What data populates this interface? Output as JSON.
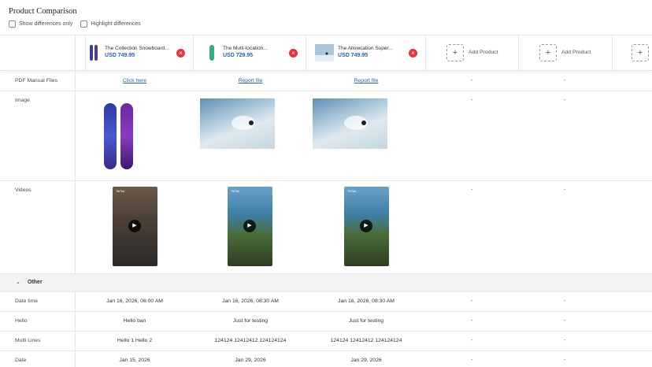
{
  "title": "Product Comparison",
  "options": {
    "show_differences_only": "Show differences only",
    "highlight_differences": "Highlight differences"
  },
  "products": [
    {
      "name": "The Collection Snowboard...",
      "price": "USD 749.95"
    },
    {
      "name": "The Multi-location...",
      "price": "USD 729.95"
    },
    {
      "name": "The Allowcation Super...",
      "price": "USD 749.95"
    }
  ],
  "add_product_label": "Add Product",
  "add_icon": "+",
  "remove_icon": "×",
  "dash": "-",
  "rows": {
    "pdf": {
      "label": "PDF Manual Files",
      "values": [
        "Click here",
        "Report file",
        "Report file"
      ]
    },
    "image": {
      "label": "Image"
    },
    "videos": {
      "label": "Videos",
      "video_tag": "TikTok"
    },
    "section": {
      "label": "Other",
      "icon": "chevron-down-icon"
    },
    "datetime": {
      "label": "Date time",
      "values": [
        "Jan 16, 2026, 06:00 AM",
        "Jan 16, 2026, 08:30 AM",
        "Jan 16, 2026, 08:30 AM"
      ]
    },
    "hello": {
      "label": "Hello",
      "values": [
        "Hello ban",
        "Just for testing",
        "Just for testing"
      ]
    },
    "multilines": {
      "label": "Multi Lines",
      "values": [
        "Hello 1 Hello 2",
        "124124 12412412 124124124",
        "124124 12412412 124124124"
      ]
    },
    "date": {
      "label": "Date",
      "values": [
        "Jan 15, 2026",
        "Jan 29, 2026",
        "Jan 29, 2026"
      ]
    }
  },
  "colors": {
    "accent": "#2a5fb0",
    "remove": "#e0383e"
  }
}
